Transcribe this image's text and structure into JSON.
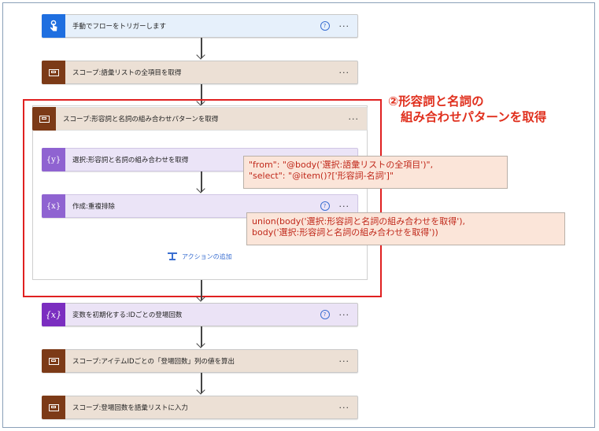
{
  "flow": {
    "trigger": {
      "label": "手動でフローをトリガーします",
      "icon": "hand-touch-icon"
    },
    "scope1": {
      "label": "スコープ:語彙リストの全項目を取得",
      "icon": "scope-icon"
    },
    "scope2": {
      "label": "スコープ:形容詞と名詞の組み合わせパターンを取得",
      "icon": "scope-icon",
      "actions": [
        {
          "label": "選択:形容詞と名詞の組み合わせを取得",
          "icon": "select-icon"
        },
        {
          "label": "作成:重複排除",
          "icon": "compose-icon"
        }
      ],
      "add_action_label": "アクションの追加"
    },
    "var_init": {
      "label": "変数を初期化する:IDごとの登場回数",
      "icon": "variable-icon"
    },
    "scope3": {
      "label": "スコープ:アイテムIDごとの「登場回数」列の値を算出",
      "icon": "scope-icon"
    },
    "scope4": {
      "label": "スコープ:登場回数を語彙リストに入力",
      "icon": "scope-icon"
    }
  },
  "annotation": {
    "line1": "②形容詞と名詞の",
    "line2": "組み合わせパターンを取得"
  },
  "callouts": {
    "select": "\"from\": \"@body('選択:語彙リストの全項目')\",\n\"select\": \"@item()?['形容詞-名詞']\"",
    "compose": "union(body('選択:形容詞と名詞の組み合わせを取得'),\nbody('選択:形容詞と名詞の組み合わせを取得'))"
  },
  "ui": {
    "more": "···",
    "help": "?"
  },
  "colors": {
    "trigger_accent": "#1f6fe0",
    "scope_accent": "#7c3a17",
    "variable_accent": "#7b2ec0",
    "action_accent": "#8f63d1",
    "highlight": "#e02020"
  }
}
